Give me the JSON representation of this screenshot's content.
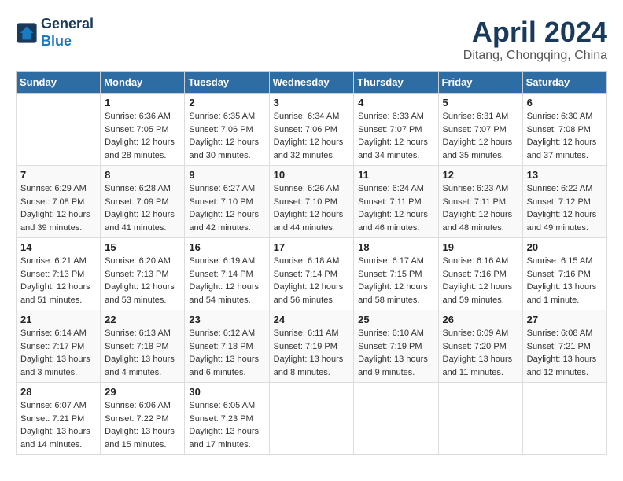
{
  "header": {
    "logo_line1": "General",
    "logo_line2": "Blue",
    "month_title": "April 2024",
    "subtitle": "Ditang, Chongqing, China"
  },
  "days_of_week": [
    "Sunday",
    "Monday",
    "Tuesday",
    "Wednesday",
    "Thursday",
    "Friday",
    "Saturday"
  ],
  "weeks": [
    [
      {
        "day": "",
        "info": ""
      },
      {
        "day": "1",
        "info": "Sunrise: 6:36 AM\nSunset: 7:05 PM\nDaylight: 12 hours\nand 28 minutes."
      },
      {
        "day": "2",
        "info": "Sunrise: 6:35 AM\nSunset: 7:06 PM\nDaylight: 12 hours\nand 30 minutes."
      },
      {
        "day": "3",
        "info": "Sunrise: 6:34 AM\nSunset: 7:06 PM\nDaylight: 12 hours\nand 32 minutes."
      },
      {
        "day": "4",
        "info": "Sunrise: 6:33 AM\nSunset: 7:07 PM\nDaylight: 12 hours\nand 34 minutes."
      },
      {
        "day": "5",
        "info": "Sunrise: 6:31 AM\nSunset: 7:07 PM\nDaylight: 12 hours\nand 35 minutes."
      },
      {
        "day": "6",
        "info": "Sunrise: 6:30 AM\nSunset: 7:08 PM\nDaylight: 12 hours\nand 37 minutes."
      }
    ],
    [
      {
        "day": "7",
        "info": "Sunrise: 6:29 AM\nSunset: 7:08 PM\nDaylight: 12 hours\nand 39 minutes."
      },
      {
        "day": "8",
        "info": "Sunrise: 6:28 AM\nSunset: 7:09 PM\nDaylight: 12 hours\nand 41 minutes."
      },
      {
        "day": "9",
        "info": "Sunrise: 6:27 AM\nSunset: 7:10 PM\nDaylight: 12 hours\nand 42 minutes."
      },
      {
        "day": "10",
        "info": "Sunrise: 6:26 AM\nSunset: 7:10 PM\nDaylight: 12 hours\nand 44 minutes."
      },
      {
        "day": "11",
        "info": "Sunrise: 6:24 AM\nSunset: 7:11 PM\nDaylight: 12 hours\nand 46 minutes."
      },
      {
        "day": "12",
        "info": "Sunrise: 6:23 AM\nSunset: 7:11 PM\nDaylight: 12 hours\nand 48 minutes."
      },
      {
        "day": "13",
        "info": "Sunrise: 6:22 AM\nSunset: 7:12 PM\nDaylight: 12 hours\nand 49 minutes."
      }
    ],
    [
      {
        "day": "14",
        "info": "Sunrise: 6:21 AM\nSunset: 7:13 PM\nDaylight: 12 hours\nand 51 minutes."
      },
      {
        "day": "15",
        "info": "Sunrise: 6:20 AM\nSunset: 7:13 PM\nDaylight: 12 hours\nand 53 minutes."
      },
      {
        "day": "16",
        "info": "Sunrise: 6:19 AM\nSunset: 7:14 PM\nDaylight: 12 hours\nand 54 minutes."
      },
      {
        "day": "17",
        "info": "Sunrise: 6:18 AM\nSunset: 7:14 PM\nDaylight: 12 hours\nand 56 minutes."
      },
      {
        "day": "18",
        "info": "Sunrise: 6:17 AM\nSunset: 7:15 PM\nDaylight: 12 hours\nand 58 minutes."
      },
      {
        "day": "19",
        "info": "Sunrise: 6:16 AM\nSunset: 7:16 PM\nDaylight: 12 hours\nand 59 minutes."
      },
      {
        "day": "20",
        "info": "Sunrise: 6:15 AM\nSunset: 7:16 PM\nDaylight: 13 hours\nand 1 minute."
      }
    ],
    [
      {
        "day": "21",
        "info": "Sunrise: 6:14 AM\nSunset: 7:17 PM\nDaylight: 13 hours\nand 3 minutes."
      },
      {
        "day": "22",
        "info": "Sunrise: 6:13 AM\nSunset: 7:18 PM\nDaylight: 13 hours\nand 4 minutes."
      },
      {
        "day": "23",
        "info": "Sunrise: 6:12 AM\nSunset: 7:18 PM\nDaylight: 13 hours\nand 6 minutes."
      },
      {
        "day": "24",
        "info": "Sunrise: 6:11 AM\nSunset: 7:19 PM\nDaylight: 13 hours\nand 8 minutes."
      },
      {
        "day": "25",
        "info": "Sunrise: 6:10 AM\nSunset: 7:19 PM\nDaylight: 13 hours\nand 9 minutes."
      },
      {
        "day": "26",
        "info": "Sunrise: 6:09 AM\nSunset: 7:20 PM\nDaylight: 13 hours\nand 11 minutes."
      },
      {
        "day": "27",
        "info": "Sunrise: 6:08 AM\nSunset: 7:21 PM\nDaylight: 13 hours\nand 12 minutes."
      }
    ],
    [
      {
        "day": "28",
        "info": "Sunrise: 6:07 AM\nSunset: 7:21 PM\nDaylight: 13 hours\nand 14 minutes."
      },
      {
        "day": "29",
        "info": "Sunrise: 6:06 AM\nSunset: 7:22 PM\nDaylight: 13 hours\nand 15 minutes."
      },
      {
        "day": "30",
        "info": "Sunrise: 6:05 AM\nSunset: 7:23 PM\nDaylight: 13 hours\nand 17 minutes."
      },
      {
        "day": "",
        "info": ""
      },
      {
        "day": "",
        "info": ""
      },
      {
        "day": "",
        "info": ""
      },
      {
        "day": "",
        "info": ""
      }
    ]
  ]
}
